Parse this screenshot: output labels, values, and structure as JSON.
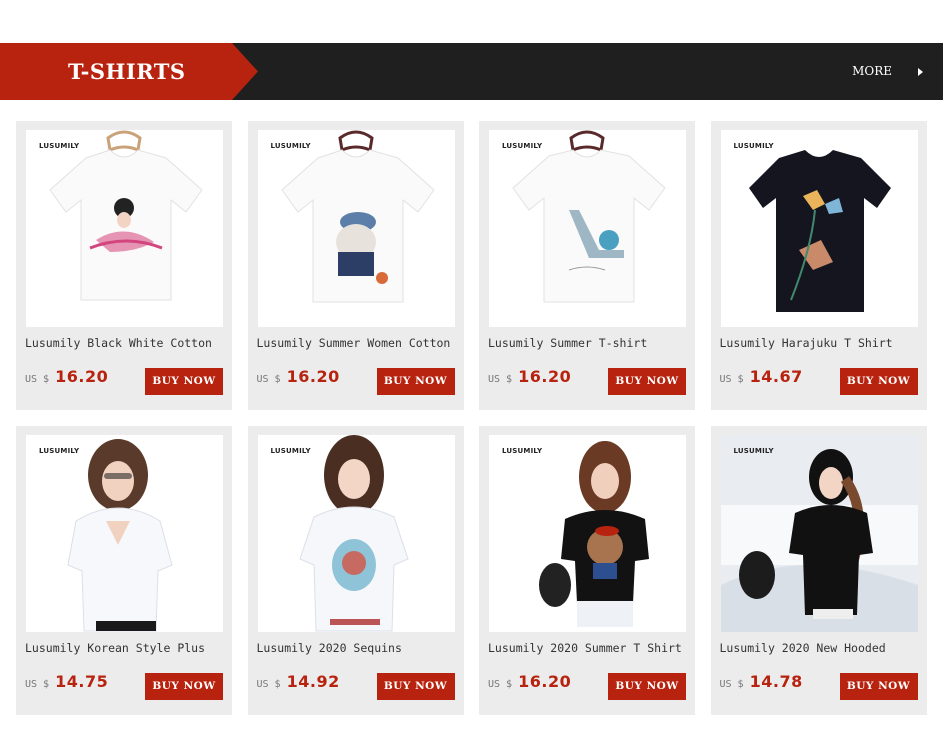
{
  "section": {
    "title": "T-SHIRTS",
    "more_label": "MORE"
  },
  "products": [
    {
      "brand": "LUSUMILY",
      "title": "Lusumily Black White Cotton",
      "currency": "US $",
      "price": "16.20",
      "buy_label": "BUY NOW"
    },
    {
      "brand": "LUSUMILY",
      "title": "Lusumily Summer Women Cotton",
      "currency": "US $",
      "price": "16.20",
      "buy_label": "BUY NOW"
    },
    {
      "brand": "LUSUMILY",
      "title": "Lusumily Summer T-shirt",
      "currency": "US $",
      "price": "16.20",
      "buy_label": "BUY NOW"
    },
    {
      "brand": "LUSUMILY",
      "title": "Lusumily Harajuku T Shirt",
      "currency": "US $",
      "price": "14.67",
      "buy_label": "BUY NOW"
    },
    {
      "brand": "LUSUMILY",
      "title": "Lusumily Korean Style Plus",
      "currency": "US $",
      "price": "14.75",
      "buy_label": "BUY NOW"
    },
    {
      "brand": "LUSUMILY",
      "title": "Lusumily 2020 Sequins",
      "currency": "US $",
      "price": "14.92",
      "buy_label": "BUY NOW"
    },
    {
      "brand": "LUSUMILY",
      "title": "Lusumily 2020 Summer T Shirt",
      "currency": "US $",
      "price": "16.20",
      "buy_label": "BUY NOW"
    },
    {
      "brand": "LUSUMILY",
      "title": "Lusumily 2020 New Hooded",
      "currency": "US $",
      "price": "14.78",
      "buy_label": "BUY NOW"
    }
  ],
  "colors": {
    "accent": "#b8230f",
    "banner": "#1f1f1f",
    "card_bg": "#ececec"
  }
}
